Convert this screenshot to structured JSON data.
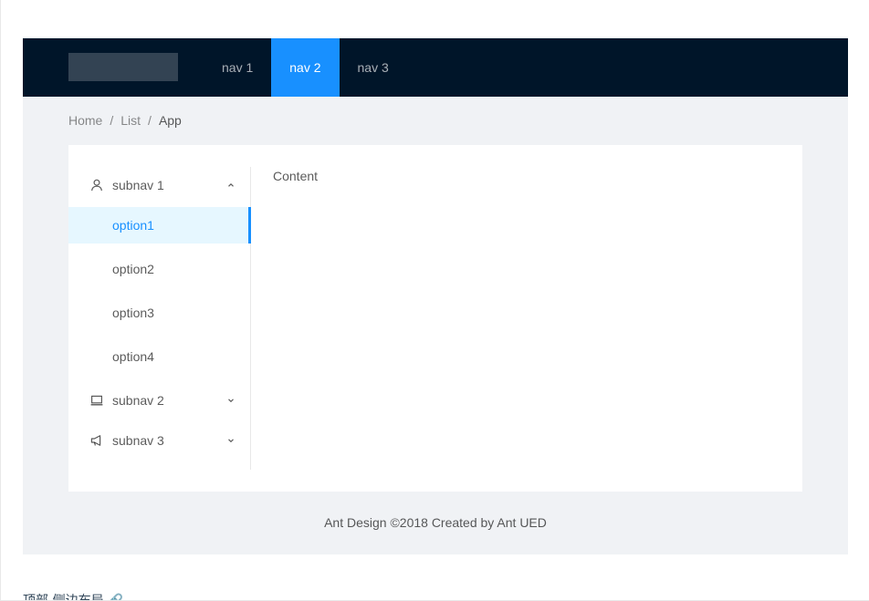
{
  "header": {
    "nav": [
      {
        "label": "nav 1",
        "active": false
      },
      {
        "label": "nav 2",
        "active": true
      },
      {
        "label": "nav 3",
        "active": false
      }
    ]
  },
  "breadcrumb": [
    "Home",
    "List",
    "App"
  ],
  "sider": {
    "submenus": [
      {
        "label": "subnav 1",
        "icon": "user-icon",
        "expanded": true
      },
      {
        "label": "subnav 2",
        "icon": "laptop-icon",
        "expanded": false
      },
      {
        "label": "subnav 3",
        "icon": "notification-icon",
        "expanded": false
      }
    ],
    "options": [
      {
        "label": "option1",
        "selected": true
      },
      {
        "label": "option2",
        "selected": false
      },
      {
        "label": "option3",
        "selected": false
      },
      {
        "label": "option4",
        "selected": false
      }
    ]
  },
  "main": {
    "content": "Content"
  },
  "footer": {
    "text": "Ant Design ©2018 Created by Ant UED"
  },
  "caption": {
    "text": "顶部-侧边布局 🔗"
  },
  "colors": {
    "header_bg": "#001529",
    "primary": "#1890ff",
    "layout_bg": "#f0f2f5",
    "selected_bg": "#e6f7ff"
  }
}
